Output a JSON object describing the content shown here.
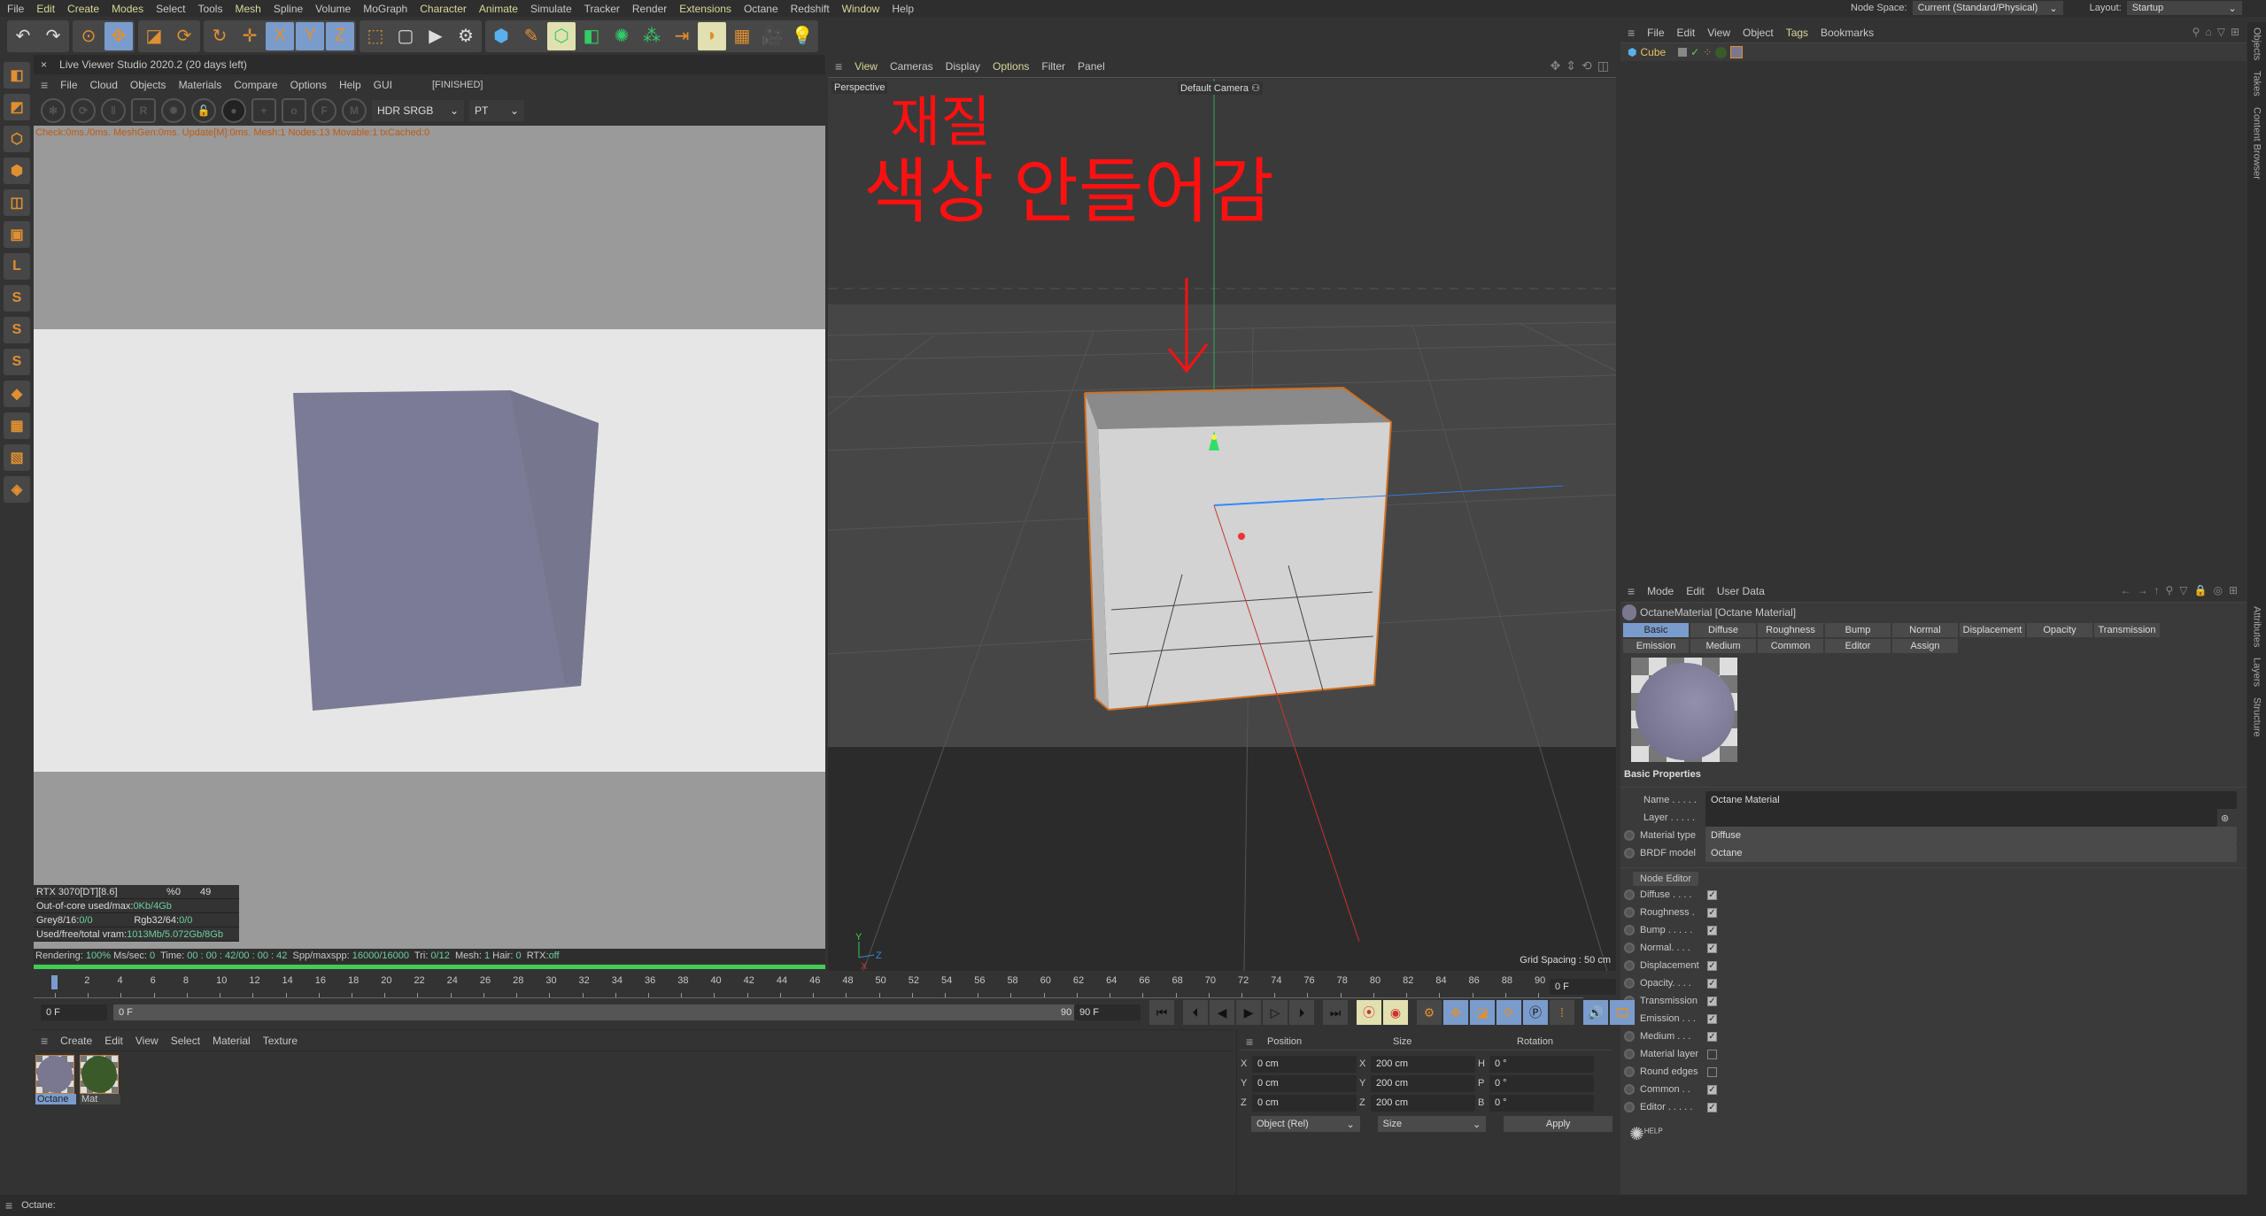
{
  "menu": [
    "File",
    "Edit",
    "Create",
    "Modes",
    "Select",
    "Tools",
    "Mesh",
    "Spline",
    "Volume",
    "MoGraph",
    "Character",
    "Animate",
    "Simulate",
    "Tracker",
    "Render",
    "Extensions",
    "Octane",
    "Redshift",
    "Window",
    "Help"
  ],
  "menu_highlight": [
    "Edit",
    "Create",
    "Modes",
    "Mesh",
    "Character",
    "Animate",
    "Extensions",
    "Window"
  ],
  "top_right": {
    "node_space_label": "Node Space:",
    "node_space_value": "Current (Standard/Physical)",
    "layout_label": "Layout:",
    "layout_value": "Startup"
  },
  "toolbar_icons": [
    [
      "undo-icon",
      "↶"
    ],
    [
      "redo-icon",
      "↷"
    ],
    [
      "select-icon",
      "⊙"
    ],
    [
      "move-icon",
      "✥"
    ],
    [
      "scale-icon",
      "◪"
    ],
    [
      "rotate-icon",
      "⟳"
    ],
    [
      "psr-icon",
      "↻"
    ],
    [
      "axis-icon",
      "✛"
    ],
    [
      "x-axis-icon",
      "X"
    ],
    [
      "y-axis-icon",
      "Y"
    ],
    [
      "z-axis-icon",
      "Z"
    ],
    [
      "coord-system-icon",
      "⬚"
    ],
    [
      "render-view-icon",
      "▢"
    ],
    [
      "render-icon",
      "▶"
    ],
    [
      "render-settings-icon",
      "⚙"
    ],
    [
      "cube-icon",
      "⬢"
    ],
    [
      "pen-icon",
      "✎"
    ],
    [
      "subdivision-icon",
      "⬡"
    ],
    [
      "extrude-icon",
      "◧"
    ],
    [
      "mograph-icon",
      "✺"
    ],
    [
      "cloner-icon",
      "⁂"
    ],
    [
      "deformer-icon",
      "⇥"
    ],
    [
      "field-icon",
      "◗"
    ],
    [
      "floor-icon",
      "▦"
    ],
    [
      "camera-icon",
      "🎥"
    ],
    [
      "light-icon",
      "💡"
    ]
  ],
  "left_tools": [
    "◧",
    "◩",
    "⬡",
    "⬢",
    "◫",
    "▣",
    "L",
    "S",
    "S",
    "S",
    "◆",
    "▦",
    "▧",
    "◈"
  ],
  "live_viewer": {
    "title": "Live Viewer Studio 2020.2 (20 days left)",
    "menu": [
      "File",
      "Cloud",
      "Objects",
      "Materials",
      "Compare",
      "Options",
      "Help",
      "GUI"
    ],
    "status": "[FINISHED]",
    "color_space": "HDR SRGB",
    "kernel": "PT",
    "info": "Check:0ms./0ms. MeshGen:0ms. Update[M]:0ms. Mesh:1 Nodes:13 Movable:1 txCached:0",
    "gpu": {
      "name": "RTX 3070[DT][8.6]",
      "pct": "%0",
      "temp": "49"
    },
    "out_of_core": {
      "label": "Out-of-core used/max:",
      "value": "0Kb/4Gb"
    },
    "grey": {
      "label": "Grey8/16: ",
      "value": "0/0"
    },
    "rgb": {
      "label": "Rgb32/64: ",
      "value": "0/0"
    },
    "vram": {
      "label": "Used/free/total vram: ",
      "value": "1013Mb/5.072Gb/8Gb"
    },
    "render": {
      "rendering_label": "Rendering: ",
      "rendering": "100%",
      "ms_label": " Ms/sec: ",
      "ms": "0",
      "time_label": "  Time: ",
      "time": "00 : 00 : 42/00 : 00 : 42",
      "spp_label": "  Spp/maxspp: ",
      "spp": "16000/16000",
      "tri_label": "  Tri: ",
      "tri": "0/12",
      "mesh_label": "  Mesh: ",
      "mesh": "1",
      "hair_label": " Hair: ",
      "hair": "0",
      "rtx_label": "  RTX:",
      "rtx": "off"
    },
    "progress": 1.0
  },
  "viewport": {
    "menu": [
      "View",
      "Cameras",
      "Display",
      "Options",
      "Filter",
      "Panel"
    ],
    "menu_highlight": [
      "View",
      "Options"
    ],
    "view_name": "Perspective",
    "camera": "Default Camera",
    "grid_spacing": "Grid Spacing : 50 cm",
    "annotation_line1": "재질",
    "annotation_line2": "색상 안들어감",
    "annotation_color": "#ff1010",
    "axis_labels": [
      "Y",
      "Z",
      "X"
    ]
  },
  "objects": {
    "menu": [
      "File",
      "Edit",
      "View",
      "Object",
      "Tags",
      "Bookmarks"
    ],
    "items": [
      {
        "name": "Cube"
      }
    ]
  },
  "attributes": {
    "menu": [
      "Mode",
      "Edit",
      "User Data"
    ],
    "title": "OctaneMaterial [Octane Material]",
    "tabs": [
      "Basic",
      "Diffuse",
      "Roughness",
      "Bump",
      "Normal",
      "Displacement",
      "Opacity",
      "Transmission",
      "Emission",
      "Medium",
      "Common",
      "Editor",
      "Assign"
    ],
    "active_tab": "Basic",
    "section": "Basic Properties",
    "name_label": "Name . . . . .",
    "name_value": "Octane Material",
    "layer_label": "Layer . . . . .",
    "layer_value": "",
    "material_type_label": "Material type",
    "material_type": "Diffuse",
    "brdf_label": "BRDF model",
    "brdf": "Octane",
    "node_editor": "Node Editor",
    "channels": [
      {
        "label": "Diffuse . . . .",
        "on": true
      },
      {
        "label": "Roughness .",
        "on": true
      },
      {
        "label": "Bump . . . . .",
        "on": true
      },
      {
        "label": "Normal. . . .",
        "on": true
      },
      {
        "label": "Displacement",
        "on": true
      },
      {
        "label": "Opacity. . . .",
        "on": true
      },
      {
        "label": "Transmission",
        "on": true
      },
      {
        "label": "Emission . . .",
        "on": true
      },
      {
        "label": "Medium . . .",
        "on": true
      },
      {
        "label": "Material layer",
        "on": false
      },
      {
        "label": "Round edges",
        "on": false
      },
      {
        "label": "Common . .",
        "on": true
      },
      {
        "label": "Editor . . . . .",
        "on": true
      }
    ],
    "help": "HELP"
  },
  "side_tabs": {
    "top": [
      "Objects",
      "Takes",
      "Content Browser"
    ],
    "bottom": [
      "Attributes",
      "Layers",
      "Structure"
    ]
  },
  "timeline": {
    "start": 0,
    "end": 90,
    "step": 2,
    "current": "0 F",
    "range_start": "0 F",
    "range_bar_start": "0 F",
    "range_bar_end": "90 F",
    "range_end": "90 F",
    "end_field": "0 F"
  },
  "materials": {
    "menu": [
      "Create",
      "Edit",
      "View",
      "Select",
      "Material",
      "Texture"
    ],
    "items": [
      {
        "name": "Octane",
        "color": "#7a7890"
      },
      {
        "name": "Mat",
        "color": "#3a5a2a"
      }
    ]
  },
  "coords": {
    "headers": [
      "Position",
      "Size",
      "Rotation"
    ],
    "rows": [
      [
        "X",
        "0 cm",
        "X",
        "200 cm",
        "H",
        "0 °"
      ],
      [
        "Y",
        "0 cm",
        "Y",
        "200 cm",
        "P",
        "0 °"
      ],
      [
        "Z",
        "0 cm",
        "Z",
        "200 cm",
        "B",
        "0 °"
      ]
    ],
    "mode": "Object (Rel)",
    "size_mode": "Size",
    "apply": "Apply"
  },
  "statusbar": "Octane:"
}
